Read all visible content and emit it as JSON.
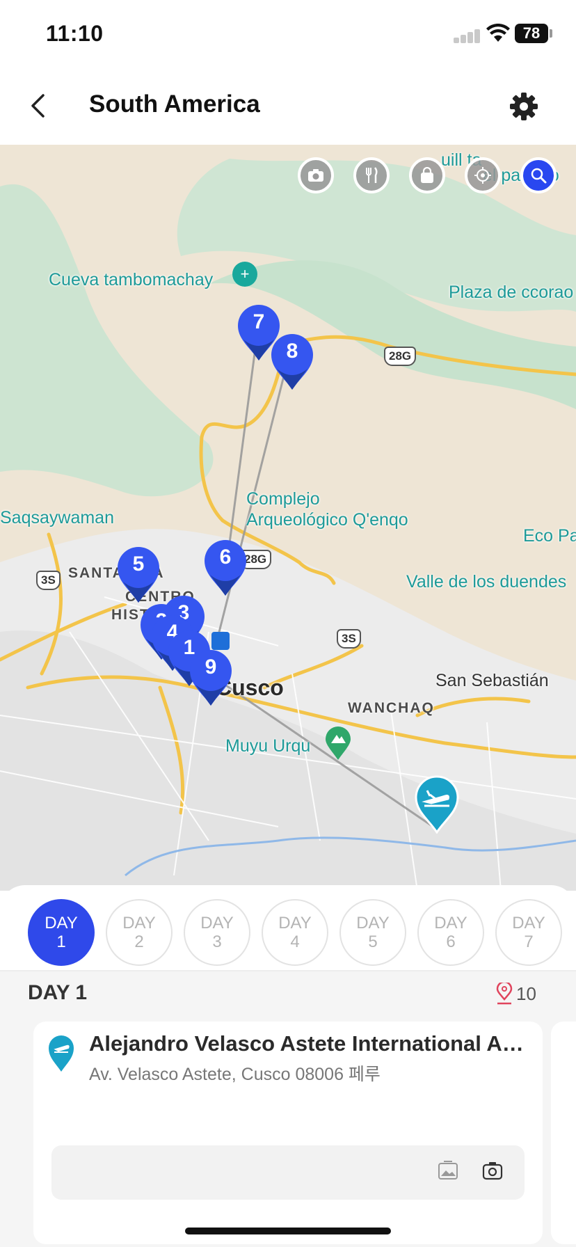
{
  "status_bar": {
    "time": "11:10",
    "battery": "78"
  },
  "header": {
    "title": "South America"
  },
  "map": {
    "labels": {
      "cueva": "Cueva tambomachay",
      "plaza": "Plaza de ccorao",
      "complejo_1": "Complejo",
      "complejo_2": "Arqueológico Q'enqo",
      "saqsay": "Saqsaywaman",
      "eco": "Eco Pa",
      "valle": "Valle de los duendes",
      "santa_ana": "SANTA ANA",
      "centro_1": "CENTRO",
      "centro_2": "HISTÓRICO",
      "cusco": "Cusco",
      "san_sebastian": "San Sebastián",
      "wanchaq": "WANCHAQ",
      "muyu": "Muyu Urqu",
      "top_right_1": "uill  ta",
      "top_right_2": "el paraíso"
    },
    "shields": {
      "s1": "28G",
      "s2": "28G",
      "s3": "3S",
      "s4": "3S"
    },
    "pins": {
      "p1": "1",
      "p2": "2",
      "p3": "3",
      "p4": "4",
      "p5": "5",
      "p6": "6",
      "p7": "7",
      "p8": "8",
      "p9": "9"
    },
    "tools": [
      "camera-icon",
      "restaurant-icon",
      "shopping-bag-icon",
      "location-target-icon",
      "search-icon"
    ]
  },
  "days": {
    "d1": {
      "top": "DAY",
      "num": "1"
    },
    "d2": {
      "top": "DAY",
      "num": "2"
    },
    "d3": {
      "top": "DAY",
      "num": "3"
    },
    "d4": {
      "top": "DAY",
      "num": "4"
    },
    "d5": {
      "top": "DAY",
      "num": "5"
    },
    "d6": {
      "top": "DAY",
      "num": "6"
    },
    "d7": {
      "top": "DAY",
      "num": "7"
    }
  },
  "day_section": {
    "heading": "DAY 1",
    "place_count": "10",
    "card": {
      "title": "Alejandro Velasco Astete International Airport",
      "address": "Av. Velasco Astete, Cusco 08006 페루"
    }
  },
  "colors": {
    "accent": "#2f49ea",
    "pin_blue": "#3556f0",
    "airport_teal": "#1aa2c8",
    "route": "#9a9a9a"
  }
}
